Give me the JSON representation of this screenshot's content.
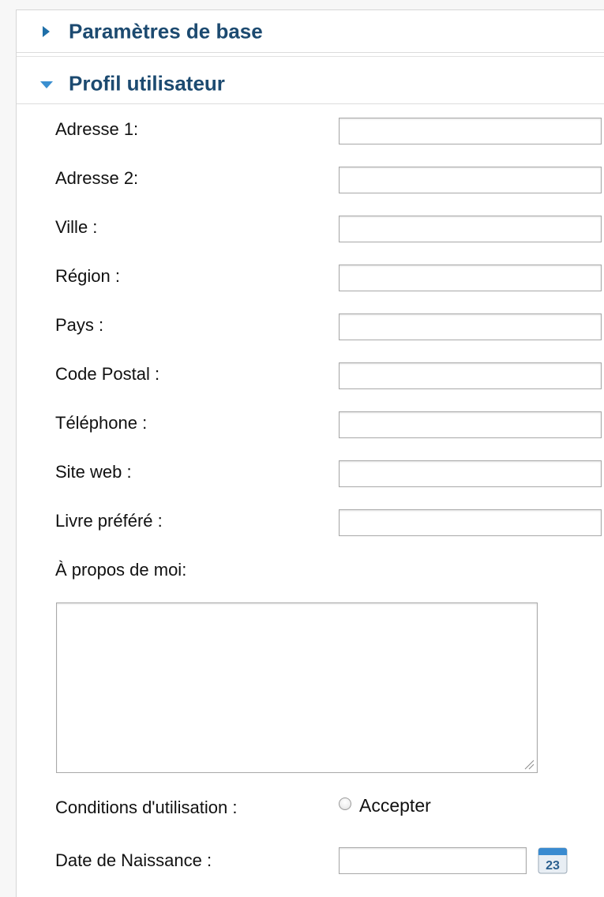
{
  "panels": {
    "basic": {
      "title": "Paramètres de base",
      "state": "collapsed",
      "arrow_icon": "triangle-right-icon"
    },
    "profile": {
      "title": "Profil utilisateur",
      "state": "expanded",
      "arrow_icon": "triangle-down-icon"
    }
  },
  "profile": {
    "fields": [
      {
        "label": "Adresse 1:",
        "value": ""
      },
      {
        "label": "Adresse 2:",
        "value": ""
      },
      {
        "label": "Ville :",
        "value": ""
      },
      {
        "label": "Région :",
        "value": ""
      },
      {
        "label": "Pays :",
        "value": ""
      },
      {
        "label": "Code Postal :",
        "value": ""
      },
      {
        "label": "Téléphone :",
        "value": ""
      },
      {
        "label": "Site web :",
        "value": ""
      },
      {
        "label": "Livre préféré :",
        "value": ""
      }
    ],
    "about": {
      "label": "À propos de moi:",
      "value": ""
    },
    "terms": {
      "label": "Conditions d'utilisation :",
      "option": "Accepter",
      "checked": false
    },
    "dob": {
      "label": "Date de Naissance :",
      "value": "",
      "calendar_icon_text": "23"
    }
  },
  "colors": {
    "header_text": "#1c4a70",
    "arrow_collapsed": "#1f6fa8",
    "arrow_expanded": "#3a8fd0",
    "calendar_top": "#3a8bd0"
  }
}
